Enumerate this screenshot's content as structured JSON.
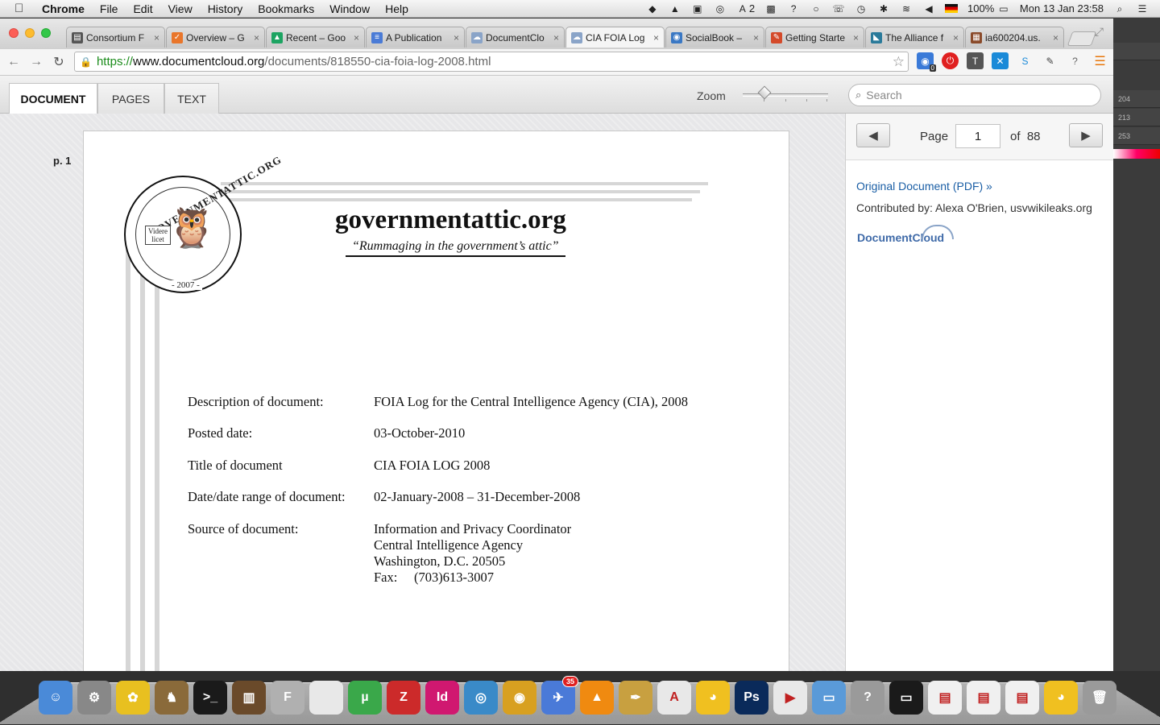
{
  "menubar": {
    "apple": "",
    "items": [
      "Chrome",
      "File",
      "Edit",
      "View",
      "History",
      "Bookmarks",
      "Window",
      "Help"
    ],
    "status": {
      "adobe_count": "2",
      "battery": "100%",
      "datetime": "Mon 13 Jan  23:58"
    }
  },
  "browser": {
    "tabs": [
      {
        "label": "Consortium F",
        "color": "#555555",
        "glyph": "▤"
      },
      {
        "label": "Overview – G",
        "color": "#e9762b",
        "glyph": "✓"
      },
      {
        "label": "Recent – Goo",
        "color": "#1da462",
        "glyph": "▲"
      },
      {
        "label": "A Publication",
        "color": "#4a7bd6",
        "glyph": "≡"
      },
      {
        "label": "DocumentClo",
        "color": "#8aa4c8",
        "glyph": "☁"
      },
      {
        "label": "CIA FOIA Log",
        "color": "#8aa4c8",
        "glyph": "☁"
      },
      {
        "label": "SocialBook –",
        "color": "#3a78c4",
        "glyph": "◉"
      },
      {
        "label": "Getting Starte",
        "color": "#d44a2a",
        "glyph": "✎"
      },
      {
        "label": "The Alliance f",
        "color": "#2a7a9a",
        "glyph": "◣"
      },
      {
        "label": "ia600204.us.",
        "color": "#8a4a2a",
        "glyph": "▦"
      }
    ],
    "active_tab_index": 5,
    "url": {
      "scheme": "https://",
      "host": "www.documentcloud.org",
      "path": "/documents/818550-cia-foia-log-2008.html"
    },
    "extension_badge": "0"
  },
  "viewer": {
    "tabs": [
      "DOCUMENT",
      "PAGES",
      "TEXT"
    ],
    "active_tab": "DOCUMENT",
    "zoom_label": "Zoom",
    "zoom_level": 0.2,
    "search_placeholder": "Search",
    "page_label": "p. 1",
    "pager": {
      "page_word": "Page",
      "current_page": "1",
      "of_total": "of  88"
    },
    "sidebar": {
      "original_link": "Original Document (PDF) »",
      "contributed_by": "Contributed by: Alexa O'Brien, usvwikileaks.org",
      "logo_text": "DocumentCloud"
    }
  },
  "document": {
    "seal": {
      "ring_text": "GOVERNMENTATTIC.ORG",
      "motto_line1": "Videre",
      "motto_line2": "licet",
      "year": "- 2007 -"
    },
    "site_name": "governmentattic.org",
    "tagline": "“Rummaging in the government’s attic”",
    "fields": [
      {
        "key": "Description of document:",
        "value": "FOIA Log for the Central Intelligence Agency (CIA), 2008"
      },
      {
        "key": "Posted date:",
        "value": "03-October-2010"
      },
      {
        "key": "Title of document",
        "value": "CIA FOIA LOG 2008"
      },
      {
        "key": "Date/date range of document:",
        "value": "02-January-2008 – 31-December-2008"
      },
      {
        "key": "Source of document:",
        "value_lines": [
          "Information and Privacy Coordinator",
          "Central Intelligence Agency",
          "Washington, D.C. 20505",
          "Fax:     (703)613-3007"
        ]
      }
    ]
  },
  "right_app": {
    "values": [
      "204",
      "213",
      "253"
    ]
  },
  "dock": {
    "mail_badge": "35",
    "icons": [
      {
        "name": "finder",
        "color": "#4a8ad8",
        "glyph": "☺"
      },
      {
        "name": "system-preferences",
        "color": "#888888",
        "glyph": "⚙"
      },
      {
        "name": "sketch-tool",
        "color": "#e8c020",
        "glyph": "✿"
      },
      {
        "name": "chess",
        "color": "#8a6a3a",
        "glyph": "♞"
      },
      {
        "name": "terminal",
        "color": "#1a1a1a",
        "glyph": ">_"
      },
      {
        "name": "books",
        "color": "#6a4a2a",
        "glyph": "▥"
      },
      {
        "name": "font-app",
        "color": "#b0b0b0",
        "glyph": "F"
      },
      {
        "name": "document",
        "color": "#e8e8e8",
        "glyph": ""
      },
      {
        "name": "utorrent",
        "color": "#3aa84a",
        "glyph": "µ"
      },
      {
        "name": "zotero",
        "color": "#cc2a2a",
        "glyph": "Z"
      },
      {
        "name": "indesign",
        "color": "#d01870",
        "glyph": "Id"
      },
      {
        "name": "network",
        "color": "#3a8ac8",
        "glyph": "◎"
      },
      {
        "name": "chrome",
        "color": "#d8a020",
        "glyph": "◉"
      },
      {
        "name": "mail",
        "color": "#4a7ad8",
        "glyph": "✈"
      },
      {
        "name": "vlc",
        "color": "#f08a10",
        "glyph": "▲"
      },
      {
        "name": "script-editor",
        "color": "#c8a040",
        "glyph": "✒"
      },
      {
        "name": "acrobat",
        "color": "#e8e8e8",
        "glyph": "A"
      },
      {
        "name": "cyberduck",
        "color": "#f0c020",
        "glyph": "◕"
      },
      {
        "name": "photoshop",
        "color": "#0a2a5a",
        "glyph": "Ps"
      },
      {
        "name": "avi-file",
        "color": "#e8e8e8",
        "glyph": "▶"
      },
      {
        "name": "folder",
        "color": "#5a9ad8",
        "glyph": "▭"
      },
      {
        "name": "help",
        "color": "#9a9a9a",
        "glyph": "?"
      },
      {
        "name": "screenshot",
        "color": "#1a1a1a",
        "glyph": "▭"
      },
      {
        "name": "pdf-file",
        "color": "#f0f0f0",
        "glyph": "▤"
      },
      {
        "name": "doc-stack",
        "color": "#f0f0f0",
        "glyph": "▤"
      },
      {
        "name": "doc-stack-2",
        "color": "#f0f0f0",
        "glyph": "▤"
      },
      {
        "name": "duck-file",
        "color": "#f0c020",
        "glyph": "◕"
      },
      {
        "name": "trash",
        "color": "#9a9a9a",
        "glyph": "🗑"
      }
    ]
  }
}
